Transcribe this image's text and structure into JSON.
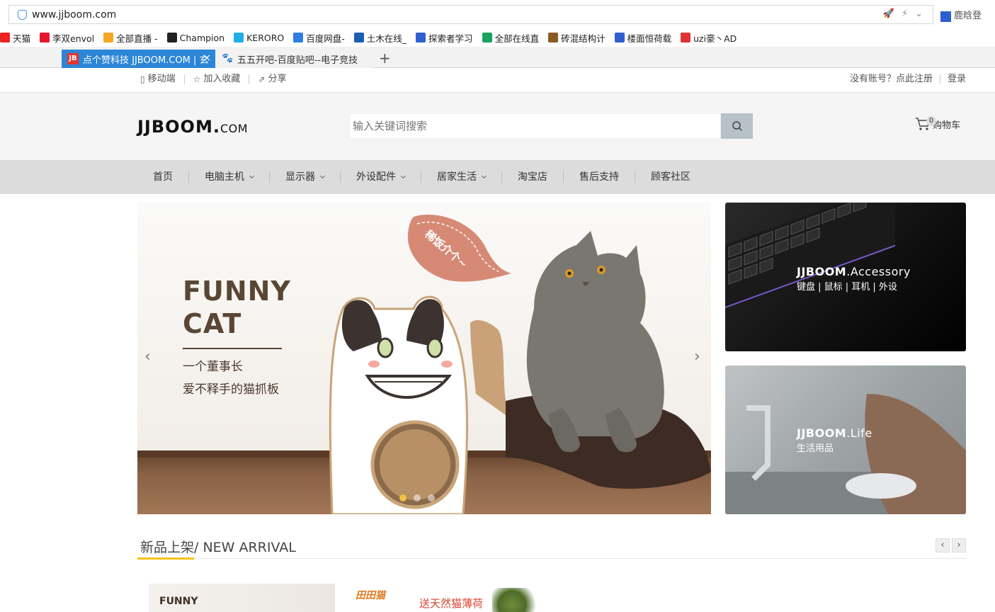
{
  "browser": {
    "url": "www.jjboom.com",
    "profile_name": "鹿晗登",
    "bookmarks": [
      {
        "label": "天猫",
        "icon": "tmall-icon",
        "color": "#e22"
      },
      {
        "label": "李双envol",
        "icon": "weibo-icon",
        "color": "#e6162d"
      },
      {
        "label": "全部直播 -",
        "icon": "douyu-icon",
        "color": "#f5a623"
      },
      {
        "label": "Champion",
        "icon": "champion-icon",
        "color": "#222"
      },
      {
        "label": "KERORO",
        "icon": "bilibili-icon",
        "color": "#23ade5"
      },
      {
        "label": "百度网盘-",
        "icon": "baidu-pan-icon",
        "color": "#2f7de0"
      },
      {
        "label": "土木在线_",
        "icon": "tumu-icon",
        "color": "#1a5fb4"
      },
      {
        "label": "探索者学习",
        "icon": "baidu-paw-icon",
        "color": "#2f5fd0"
      },
      {
        "label": "全部在线直",
        "icon": "panda-icon",
        "color": "#1aa260"
      },
      {
        "label": "砖混结构计",
        "icon": "doc-icon",
        "color": "#8a5a1f"
      },
      {
        "label": "楼面恒荷载",
        "icon": "baidu-paw-icon",
        "color": "#2f5fd0"
      },
      {
        "label": "uzi豪丶AD",
        "icon": "huya-icon",
        "color": "#d33"
      }
    ],
    "tabs": [
      {
        "label": "点个赞科技 JJBOOM.COM | 玄",
        "favicon": "JB",
        "active": true
      },
      {
        "label": "五五开吧-百度贴吧--电子竞技",
        "favicon": "paw",
        "active": false
      }
    ],
    "new_tab_symbol": "+",
    "close_symbol": "×"
  },
  "topbar": {
    "left": [
      {
        "label": "移动端",
        "icon": "mobile-icon"
      },
      {
        "label": "加入收藏",
        "icon": "star-icon"
      },
      {
        "label": "分享",
        "icon": "share-icon"
      }
    ],
    "register": "没有账号？点此注册",
    "login": "登录"
  },
  "header": {
    "logo_main": "JJBOOM.",
    "logo_suffix": "COM",
    "search_placeholder": "输入关键词搜索",
    "cart_label": "购物车",
    "cart_count": "0"
  },
  "nav": [
    {
      "label": "首页",
      "dropdown": false
    },
    {
      "label": "电脑主机",
      "dropdown": true
    },
    {
      "label": "显示器",
      "dropdown": true
    },
    {
      "label": "外设配件",
      "dropdown": true
    },
    {
      "label": "居家生活",
      "dropdown": true
    },
    {
      "label": "淘宝店",
      "dropdown": false
    },
    {
      "label": "售后支持",
      "dropdown": false
    },
    {
      "label": "顾客社区",
      "dropdown": false
    }
  ],
  "banner": {
    "title_line1": "FUNNY",
    "title_line2": "CAT",
    "subtitle_line1": "一个董事长",
    "subtitle_line2": "爱不释手的猫抓板",
    "bubble_text": "稀饭介个~",
    "prev": "‹",
    "next": "›",
    "slide_count": 3,
    "active_slide": 1
  },
  "promos": [
    {
      "brand": "JJBOOM",
      "suffix": ".Accessory",
      "subtitle": "键盘 | 鼠标 | 耳机 | 外设"
    },
    {
      "brand": "JJBOOM",
      "suffix": ".Life",
      "subtitle": "生活用品"
    }
  ],
  "new_arrival": {
    "title": "新品上架/ NEW ARRIVAL",
    "prev": "‹",
    "next": "›",
    "products": [
      {
        "text": "FUNNY"
      },
      {
        "brand": "田田猫",
        "slogan": "送天然猫薄荷"
      }
    ]
  }
}
